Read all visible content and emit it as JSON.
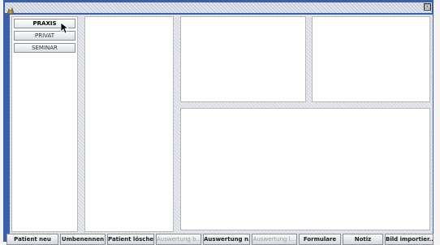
{
  "window": {
    "close_symbol": "☒",
    "icon": "app-icon"
  },
  "nav": {
    "items": [
      {
        "label": "PRAXIS",
        "active": true
      },
      {
        "label": "PRIVAT",
        "active": false
      },
      {
        "label": "SEMINAR",
        "active": false
      }
    ]
  },
  "toolbar": {
    "buttons": [
      {
        "label": "Patient neu",
        "enabled": true
      },
      {
        "label": "Umbenennen",
        "enabled": true
      },
      {
        "label": "Patient löschen",
        "enabled": true
      },
      {
        "label": "Auswertung b...",
        "enabled": false
      },
      {
        "label": "Auswertung n...",
        "enabled": true
      },
      {
        "label": "Auswertung l...",
        "enabled": false
      },
      {
        "label": "Formulare",
        "enabled": true
      },
      {
        "label": "Notiz",
        "enabled": true
      },
      {
        "label": "Bild importier...",
        "enabled": true
      }
    ]
  }
}
